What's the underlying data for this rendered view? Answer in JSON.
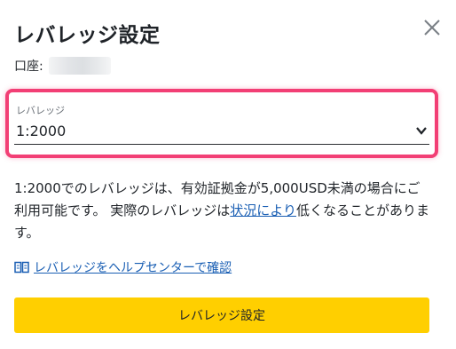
{
  "dialog": {
    "title": "レバレッジ設定",
    "close_icon": "close-icon"
  },
  "account": {
    "label": "口座:"
  },
  "leverage": {
    "label": "レバレッジ",
    "value": "1:2000",
    "icon": "chevron-down-icon"
  },
  "description": {
    "text_before": "1:2000でのレバレッジは、有効証拠金が5,000USD未満の場合にご利用可能です。 実際のレバレッジは",
    "link": "状況により",
    "text_after": "低くなることがあります。"
  },
  "help_link": {
    "icon": "book-icon",
    "label": "レバレッジをヘルプセンターで確認"
  },
  "submit": {
    "label": "レバレッジ設定"
  },
  "colors": {
    "highlight": "#f23f75",
    "button": "#ffcf00",
    "link": "#1a5fb4"
  }
}
